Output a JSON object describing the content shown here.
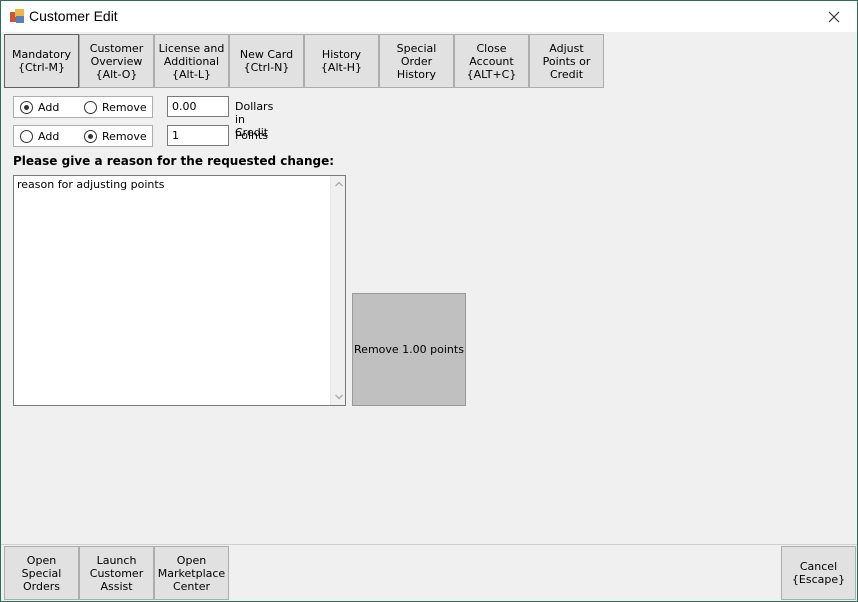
{
  "window": {
    "title": "Customer Edit"
  },
  "tabs": [
    {
      "label": "Mandatory\n{Ctrl-M}"
    },
    {
      "label": "Customer\nOverview\n{Alt-O}"
    },
    {
      "label": "License and\nAdditional\n{Alt-L}"
    },
    {
      "label": "New Card\n{Ctrl-N}"
    },
    {
      "label": "History\n{Alt-H}"
    },
    {
      "label": "Special\nOrder\nHistory"
    },
    {
      "label": "Close\nAccount\n{ALT+C}"
    },
    {
      "label": "Adjust\nPoints or\nCredit"
    }
  ],
  "credit_row": {
    "add_label": "Add",
    "remove_label": "Remove",
    "selected": "Add",
    "value": "0.00",
    "label": "Dollars in Credit"
  },
  "points_row": {
    "add_label": "Add",
    "remove_label": "Remove",
    "selected": "Remove",
    "value": "1",
    "label": "Points"
  },
  "reason": {
    "prompt": "Please give a reason for the requested change:",
    "value": "reason for adjusting points"
  },
  "action_button": {
    "label": "Remove 1.00 points"
  },
  "footer": {
    "buttons": [
      {
        "label": "Open\nSpecial\nOrders"
      },
      {
        "label": "Launch\nCustomer\nAssist"
      },
      {
        "label": "Open\nMarketplace\nCenter"
      }
    ],
    "cancel_label": "Cancel\n{Escape}"
  }
}
